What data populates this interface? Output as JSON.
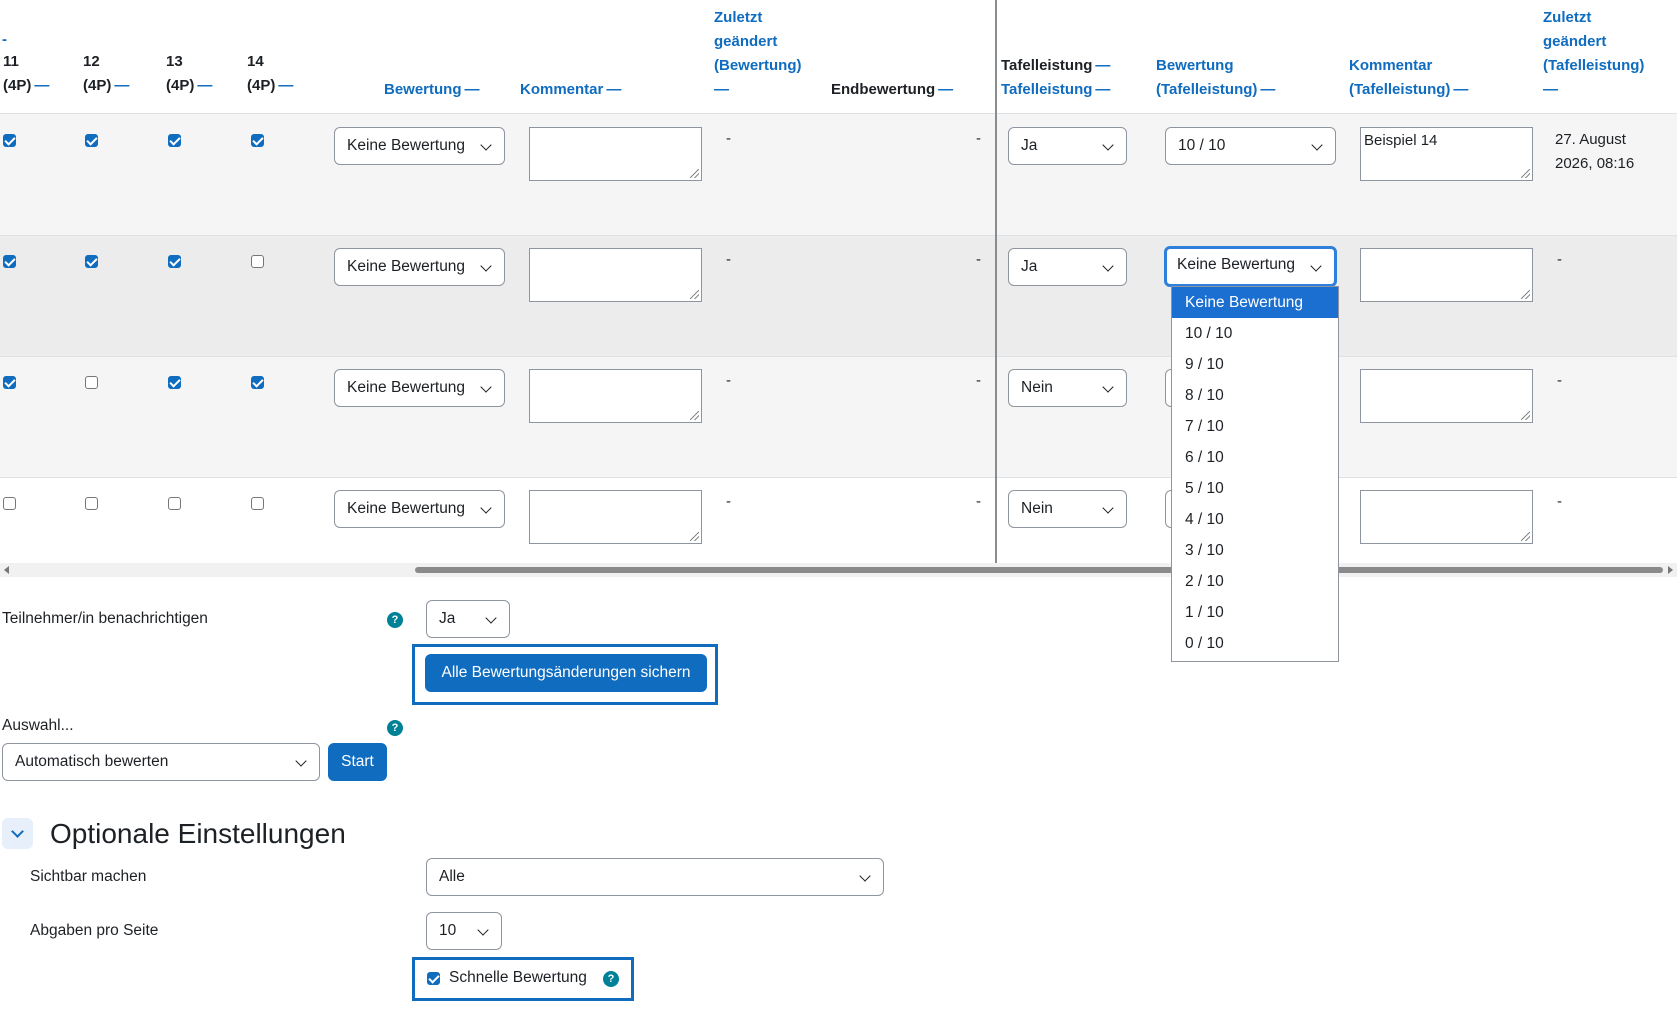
{
  "headers": {
    "dash_top": "-",
    "cols": [
      {
        "line1": "11",
        "line2": "(4P)"
      },
      {
        "line1": "12",
        "line2": "(4P)"
      },
      {
        "line1": "13",
        "line2": "(4P)"
      },
      {
        "line1": "14",
        "line2": "(4P)"
      }
    ],
    "collapse": "—",
    "bewertung": "Bewertung",
    "kommentar": "Kommentar",
    "zuletzt1": "Zuletzt",
    "zuletzt2": "geändert",
    "zuletzt3": "(Bewertung)",
    "endbewertung": "Endbewertung",
    "tafel1": "Tafelleistung",
    "tafel2": "Tafelleistung",
    "bewtafel1": "Bewertung",
    "bewtafel2": "(Tafelleistung)",
    "komtafel1": "Kommentar",
    "komtafel2": "(Tafelleistung)",
    "zuletzt_tafel1": "Zuletzt",
    "zuletzt_tafel2": "geändert",
    "zuletzt_tafel3": "(Tafelleistung)"
  },
  "rows": [
    {
      "checks": [
        true,
        true,
        true,
        true
      ],
      "grade": "Keine Bewertung",
      "comment": "",
      "modified": "-",
      "final": "-",
      "tafel": "Ja",
      "tafel_grade": "10 / 10",
      "tafel_comment": "Beispiel 14",
      "tafel_modified_1": "27. August",
      "tafel_modified_2": "2026, 08:16"
    },
    {
      "checks": [
        true,
        true,
        true,
        false
      ],
      "grade": "Keine Bewertung",
      "comment": "",
      "modified": "-",
      "final": "-",
      "tafel": "Ja",
      "tafel_grade": "Keine Bewertung",
      "tafel_comment": "",
      "tafel_modified_1": "-",
      "tafel_modified_2": ""
    },
    {
      "checks": [
        true,
        false,
        true,
        true
      ],
      "grade": "Keine Bewertung",
      "comment": "",
      "modified": "-",
      "final": "-",
      "tafel": "Nein",
      "tafel_grade": "",
      "tafel_comment": "",
      "tafel_modified_1": "-",
      "tafel_modified_2": ""
    },
    {
      "checks": [
        false,
        false,
        false,
        false
      ],
      "grade": "Keine Bewertung",
      "comment": "",
      "modified": "-",
      "final": "-",
      "tafel": "Nein",
      "tafel_grade": "",
      "tafel_comment": "",
      "tafel_modified_1": "-",
      "tafel_modified_2": ""
    }
  ],
  "dropdown": {
    "options": [
      "Keine Bewertung",
      "10 / 10",
      "9 / 10",
      "8 / 10",
      "7 / 10",
      "6 / 10",
      "5 / 10",
      "4 / 10",
      "3 / 10",
      "2 / 10",
      "1 / 10",
      "0 / 10"
    ],
    "selected_index": 0
  },
  "notify": {
    "label": "Teilnehmer/in benachrichtigen",
    "value": "Ja"
  },
  "save_button": "Alle Bewertungsänderungen sichern",
  "bulk": {
    "label": "Auswahl...",
    "value": "Automatisch bewerten",
    "start": "Start"
  },
  "optional": {
    "title": "Optionale Einstellungen",
    "visible_label": "Sichtbar machen",
    "visible_value": "Alle",
    "perpage_label": "Abgaben pro Seite",
    "perpage_value": "10",
    "quick_label": "Schnelle Bewertung",
    "quick_checked": true
  },
  "help_icon": "?",
  "colors": {
    "primary": "#0f6cbf",
    "help": "#008196",
    "focus": "#2f7fdc"
  }
}
